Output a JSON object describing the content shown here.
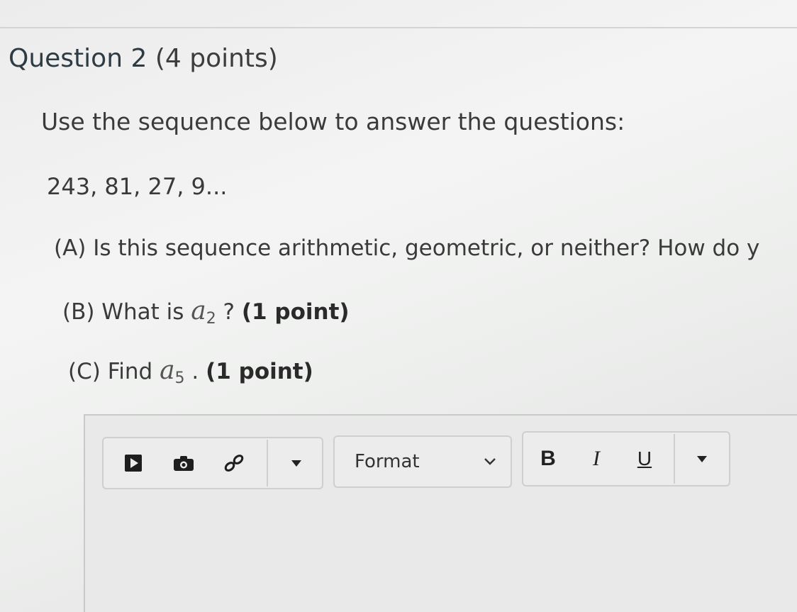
{
  "question": {
    "number_label": "Question 2",
    "points_label": "(4 points)",
    "intro": "Use the sequence below to answer the questions:",
    "sequence": "243, 81, 27, 9...",
    "parts": {
      "a": {
        "text": "(A) Is this sequence arithmetic, geometric, or neither? How do y"
      },
      "b": {
        "prefix": "(B) What is ",
        "var": "a",
        "sub": "2",
        "suffix": " ? ",
        "points": "(1 point)"
      },
      "c": {
        "prefix": "(C) Find ",
        "var": "a",
        "sub": "5",
        "suffix": " . ",
        "points": "(1 point)"
      }
    }
  },
  "editor": {
    "toolbar": {
      "media_icon": "play-media-icon",
      "image_icon": "camera-icon",
      "link_icon": "link-icon",
      "insert_dropdown_icon": "caret-down-icon",
      "format_label": "Format",
      "format_chevron_icon": "chevron-down-icon",
      "bold_label": "B",
      "italic_label": "I",
      "underline_label": "U",
      "more_dropdown_icon": "caret-down-icon"
    }
  }
}
